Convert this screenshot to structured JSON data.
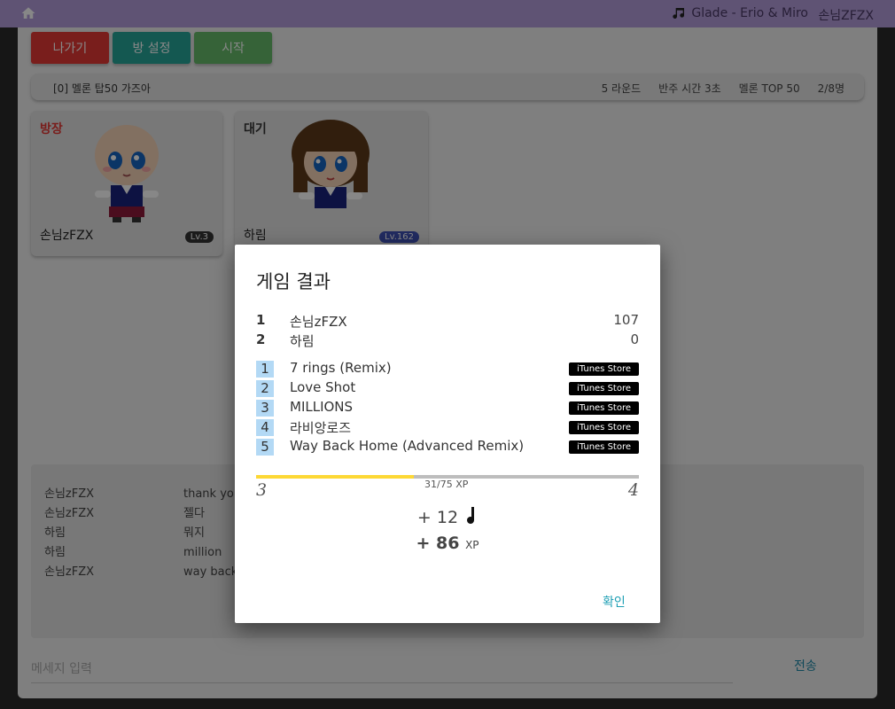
{
  "topbar": {
    "now_playing": "Glade - Erio & Miro",
    "user_name": "손님ZFZX",
    "bg_color": "#b39ddb"
  },
  "toolbar": {
    "exit_label": "나가기",
    "settings_label": "방 설정",
    "start_label": "시작"
  },
  "room": {
    "title": "[0] 멜론 탑50 가즈아",
    "rounds": "5 라운드",
    "prelude": "반주 시간 3초",
    "playlist": "멜론 TOP 50",
    "players": "2/8명"
  },
  "players": [
    {
      "status": "방장",
      "name": "손님zFZX",
      "level": "Lv.3",
      "badge_color": "#333333"
    },
    {
      "status": "대기",
      "name": "하림",
      "level": "Lv.162",
      "badge_color": "#3f51b5"
    }
  ],
  "chat": [
    {
      "user": "손님zFZX",
      "message": "thank you"
    },
    {
      "user": "손님zFZX",
      "message": "젤다"
    },
    {
      "user": "하림",
      "message": "뭐지"
    },
    {
      "user": "하림",
      "message": "million"
    },
    {
      "user": "손님zFZX",
      "message": "way back"
    }
  ],
  "message_input": {
    "placeholder": "메세지 입력"
  },
  "send_label": "전송",
  "dialog": {
    "title": "게임 결과",
    "scores": [
      {
        "rank": "1",
        "name": "손님zFZX",
        "score": "107"
      },
      {
        "rank": "2",
        "name": "하림",
        "score": "0"
      }
    ],
    "songs": [
      {
        "num": "1",
        "title": "7 rings (Remix)",
        "store": "iTunes Store"
      },
      {
        "num": "2",
        "title": "Love Shot",
        "store": "iTunes Store"
      },
      {
        "num": "3",
        "title": "MILLIONS",
        "store": "iTunes Store"
      },
      {
        "num": "4",
        "title": "라비앙로즈",
        "store": "iTunes Store"
      },
      {
        "num": "5",
        "title": "Way Back Home (Advanced Remix)",
        "store": "iTunes Store"
      }
    ],
    "xp_progress": "31/75",
    "xp_unit": "XP",
    "xp_fraction": 0.413,
    "level_from": "3",
    "level_to": "4",
    "gain_notes": "+ 12",
    "gain_xp": "+ 86",
    "gain_xp_unit": "XP",
    "confirm_label": "확인"
  }
}
